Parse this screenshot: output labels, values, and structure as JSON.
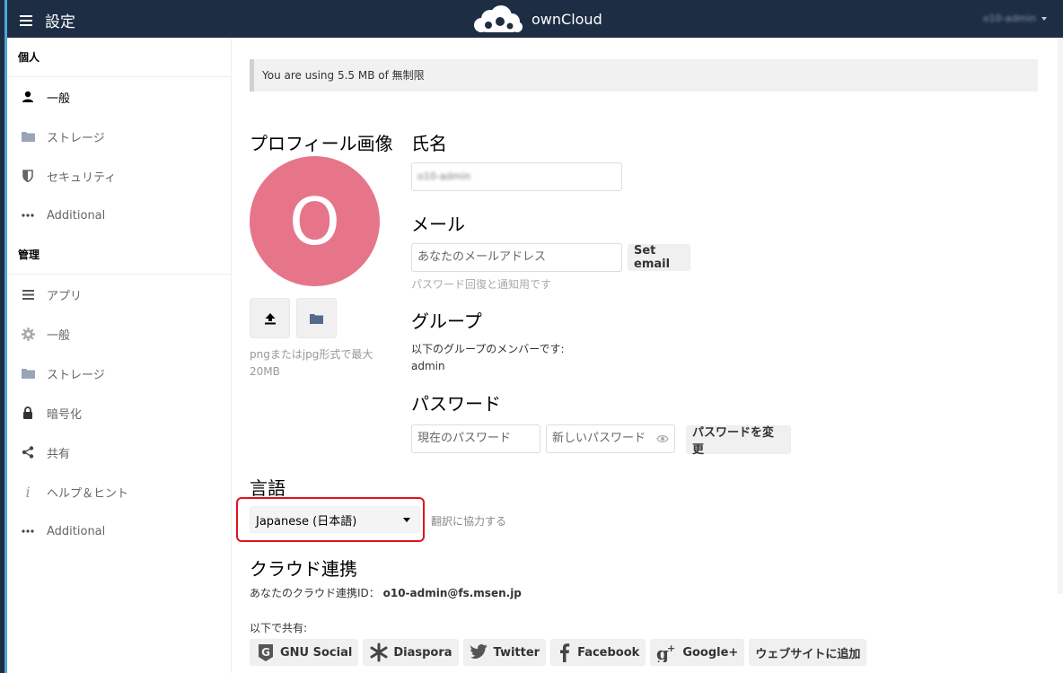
{
  "header": {
    "app_title": "設定",
    "brand": "ownCloud",
    "user_name": "o10-admin"
  },
  "sidebar": {
    "personal_heading": "個人",
    "personal_items": [
      {
        "label": "一般",
        "icon": "person-icon",
        "active": true
      },
      {
        "label": "ストレージ",
        "icon": "folder-icon",
        "active": false
      },
      {
        "label": "セキュリティ",
        "icon": "shield-icon",
        "active": false
      },
      {
        "label": "Additional",
        "icon": "more-icon",
        "active": false
      }
    ],
    "admin_heading": "管理",
    "admin_items": [
      {
        "label": "アプリ",
        "icon": "list-icon"
      },
      {
        "label": "一般",
        "icon": "gear-icon"
      },
      {
        "label": "ストレージ",
        "icon": "folder-icon"
      },
      {
        "label": "暗号化",
        "icon": "lock-icon"
      },
      {
        "label": "共有",
        "icon": "share-icon"
      },
      {
        "label": "ヘルプ＆ヒント",
        "icon": "info-icon"
      },
      {
        "label": "Additional",
        "icon": "more-icon"
      }
    ]
  },
  "quota": {
    "text": "You are using 5.5 MB of 無制限"
  },
  "profile": {
    "heading": "プロフィール画像",
    "avatar_letter": "O",
    "avatar_color": "#e6758a",
    "note": "pngまたはjpg形式で最大20MB"
  },
  "fullname": {
    "heading": "氏名",
    "value": "o10-admin"
  },
  "email": {
    "heading": "メール",
    "placeholder": "あなたのメールアドレス",
    "button": "Set email",
    "hint": "パスワード回復と通知用です"
  },
  "groups": {
    "heading": "グループ",
    "intro": "以下のグループのメンバーです:",
    "list": "admin"
  },
  "password": {
    "heading": "パスワード",
    "current_placeholder": "現在のパスワード",
    "new_placeholder": "新しいパスワード",
    "button": "パスワードを変更"
  },
  "language": {
    "heading": "言語",
    "selected": "Japanese (日本語)",
    "help_link": "翻訳に協力する",
    "highlight_color": "#e0121c"
  },
  "federated": {
    "heading": "クラウド連携",
    "label": "あなたのクラウド連携ID：",
    "id": "o10-admin@fs.msen.jp",
    "share_intro": "以下で共有:",
    "share_buttons": [
      {
        "label": "GNU Social",
        "icon": "gnu-social-icon"
      },
      {
        "label": "Diaspora",
        "icon": "diaspora-icon"
      },
      {
        "label": "Twitter",
        "icon": "twitter-icon"
      },
      {
        "label": "Facebook",
        "icon": "facebook-icon"
      },
      {
        "label": "Google+",
        "icon": "google-plus-icon"
      },
      {
        "label": "ウェブサイトに追加",
        "icon": ""
      }
    ]
  }
}
